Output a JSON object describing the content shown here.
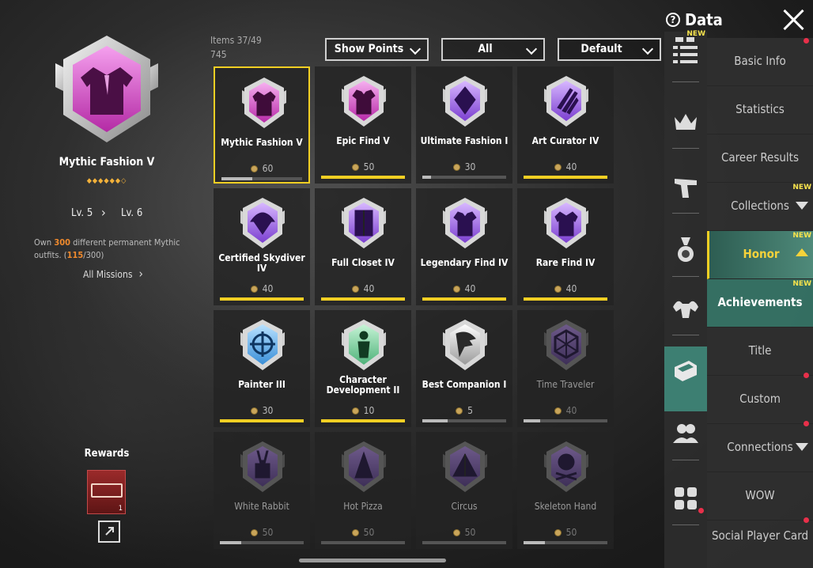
{
  "header": {
    "data_label": "Data"
  },
  "detail": {
    "title": "Mythic Fashion V",
    "dots": "◆◆◆◆◆◆◇",
    "level_from": "Lv. 5",
    "level_to": "Lv. 6",
    "desc_pre": "Own ",
    "desc_count": "300",
    "desc_mid": " different permanent Mythic outfits. (",
    "desc_progress": "115",
    "desc_post": "/300)",
    "all_missions": "All Missions",
    "rewards_label": "Rewards",
    "reward_count": "1"
  },
  "stats": {
    "items": "Items  37/49",
    "points": "745"
  },
  "filters": {
    "points": "Show Points",
    "category": "All",
    "sort": "Default"
  },
  "achievements": [
    {
      "name": "Mythic Fashion V",
      "points": "60",
      "progress": 0.38,
      "state": "selected",
      "color": "pink",
      "glyph": "jacket"
    },
    {
      "name": "Epic Find V",
      "points": "50",
      "progress": 1,
      "state": "done",
      "color": "pink",
      "glyph": "shirt"
    },
    {
      "name": "Ultimate Fashion I",
      "points": "30",
      "progress": 0.1,
      "state": "partial",
      "color": "purple",
      "glyph": "diamond"
    },
    {
      "name": "Art Curator IV",
      "points": "40",
      "progress": 1,
      "state": "done",
      "color": "purple",
      "glyph": "claw"
    },
    {
      "name": "Certified Skydiver IV",
      "points": "40",
      "progress": 1,
      "state": "done",
      "color": "purple",
      "glyph": "parachute"
    },
    {
      "name": "Full Closet IV",
      "points": "40",
      "progress": 1,
      "state": "done",
      "color": "purple",
      "glyph": "closet"
    },
    {
      "name": "Legendary Find IV",
      "points": "40",
      "progress": 1,
      "state": "done",
      "color": "purple",
      "glyph": "shirt"
    },
    {
      "name": "Rare Find IV",
      "points": "40",
      "progress": 1,
      "state": "done",
      "color": "purple",
      "glyph": "jacket"
    },
    {
      "name": "Painter III",
      "points": "30",
      "progress": 1,
      "state": "done",
      "color": "blue",
      "glyph": "target"
    },
    {
      "name": "Character Development II",
      "points": "10",
      "progress": 1,
      "state": "done",
      "color": "green",
      "glyph": "figure"
    },
    {
      "name": "Best Companion I",
      "points": "5",
      "progress": 0.3,
      "state": "partial",
      "color": "silver",
      "glyph": "eagle"
    },
    {
      "name": "Time Traveler",
      "points": "40",
      "progress": 0.2,
      "state": "locked",
      "color": "dim",
      "glyph": "hex"
    },
    {
      "name": "White Rabbit",
      "points": "50",
      "progress": 0.25,
      "state": "locked",
      "color": "dim",
      "glyph": "rabbit"
    },
    {
      "name": "Hot Pizza",
      "points": "50",
      "progress": 0,
      "state": "locked",
      "color": "dim",
      "glyph": "pizza"
    },
    {
      "name": "Circus",
      "points": "50",
      "progress": 0,
      "state": "locked",
      "color": "dim",
      "glyph": "tent"
    },
    {
      "name": "Skeleton Hand",
      "points": "50",
      "progress": 0.25,
      "state": "locked",
      "color": "dim",
      "glyph": "skull"
    }
  ],
  "side_icons": [
    {
      "name": "list-icon",
      "new": "NEW"
    },
    {
      "name": "crown-icon"
    },
    {
      "name": "pistol-icon"
    },
    {
      "name": "medal-icon"
    },
    {
      "name": "strength-icon"
    },
    {
      "name": "honor-icon"
    },
    {
      "name": "friends-icon"
    },
    {
      "name": "apps-icon"
    }
  ],
  "menu": [
    {
      "label": "Basic Info"
    },
    {
      "label": "Statistics"
    },
    {
      "label": "Career Results"
    },
    {
      "label": "Collections",
      "new": "NEW",
      "arrow": "down"
    },
    {
      "label": "Honor",
      "new": "NEW",
      "arrow": "up",
      "active": true
    },
    {
      "label": "Achievements",
      "new": "NEW",
      "sub": true
    },
    {
      "label": "Title"
    },
    {
      "label": "Custom",
      "dot": true
    },
    {
      "label": "Connections",
      "arrow": "down",
      "dot": true
    },
    {
      "label": "WOW"
    },
    {
      "label": "Social Player Card",
      "dot": true
    }
  ],
  "colors": {
    "accent": "#f2cf23",
    "teal": "#3d7f72",
    "orange": "#f08a2d",
    "badge_pink": "#c03ab0",
    "badge_purple": "#8a4fd4"
  }
}
